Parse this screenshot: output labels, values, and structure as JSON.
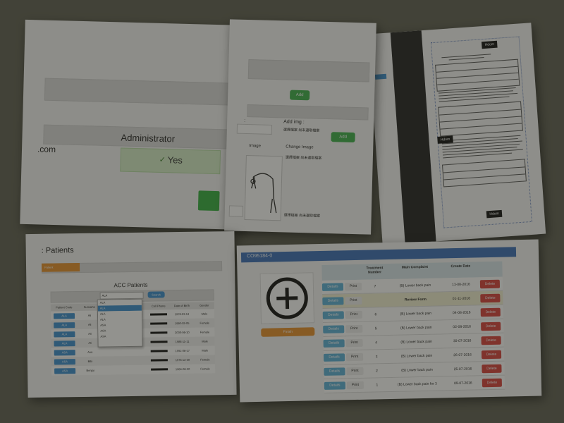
{
  "admin": {
    "role_value": "Administrator",
    "email_suffix": ".com",
    "active_value": "Yes"
  },
  "imgform": {
    "add_label": "Add",
    "add2_label": "Add",
    "colon_label": ":",
    "add_img_label": "Add img :",
    "file_choose_1": "選擇檔案  尚未選取檔案",
    "image_header": "Image",
    "change_header": "Change Image",
    "file_choose_2": "選擇檔案  尚未選取檔案",
    "file_choose_3": "選擇檔案  尚未選取檔案"
  },
  "document": {
    "top_tab": "Hdom",
    "mid_tab": "Hdom",
    "bottom_tab": "Hdom"
  },
  "acc": {
    "page_title": ": Patients",
    "orange_tab": "Patient",
    "list_title": "ACC Patients",
    "select_value": "ALA",
    "search_label": "Search",
    "columns": [
      "Patient Code",
      "Surname",
      "",
      "Cell Phone",
      "Date of Birth",
      "Gender"
    ],
    "rows": [
      {
        "code": "ALA",
        "sur": "Ali",
        "dob": "1978-03-13",
        "gender": "Male"
      },
      {
        "code": "ALA",
        "sur": "Ali",
        "dob": "1980-02-05",
        "gender": "Female"
      },
      {
        "code": "ALA",
        "sur": "Ali",
        "dob": "2000-06-10",
        "gender": "Female"
      },
      {
        "code": "ALA",
        "sur": "Ali",
        "dob": "1988-11-11",
        "gender": "Male"
      },
      {
        "code": "ASA",
        "sur": "Asa",
        "dob": "1991-06-17",
        "gender": "Male"
      },
      {
        "code": "ASA",
        "sur": "Bibi",
        "dob": "1976-12-30",
        "gender": "Female"
      },
      {
        "code": "ASA",
        "sur": "Benjai",
        "dob": "1984-08-30",
        "gender": "Female"
      }
    ],
    "dropdown": [
      "ALA",
      "ALA",
      "ALA",
      "ALA",
      "ASA",
      "ASA",
      "ASA"
    ]
  },
  "treat": {
    "header": "CO95184-0",
    "finish_label": "Finish",
    "col_number": "Treatment Number",
    "col_complaint": "Main Complaint",
    "col_date": "Create Date",
    "details_label": "Details",
    "print_label": "Print",
    "delete_label": "Delete",
    "rows": [
      {
        "num": "7",
        "complaint": "(B) Lower back pain",
        "date": "13-08-2016"
      },
      {
        "num": "",
        "complaint": "Review Form",
        "date": "01-11-2016"
      },
      {
        "num": "6",
        "complaint": "(B) Lower back pain",
        "date": "04-08-2016"
      },
      {
        "num": "5",
        "complaint": "(B) Lower back pain",
        "date": "02-08-2016"
      },
      {
        "num": "4",
        "complaint": "(B) Lower back pain",
        "date": "30-07-2016"
      },
      {
        "num": "3",
        "complaint": "(B) Lower back pain",
        "date": "26-07-2016"
      },
      {
        "num": "2",
        "complaint": "(B) Lower back pain",
        "date": "25-07-2016"
      },
      {
        "num": "1",
        "complaint": "(B) Lower back pain for 3",
        "date": "09-07-2016"
      }
    ]
  }
}
